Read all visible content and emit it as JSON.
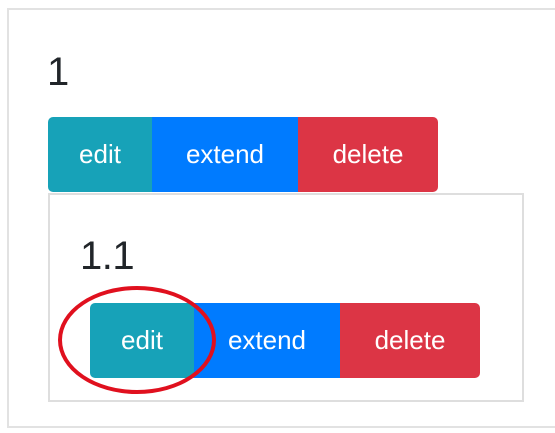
{
  "items": [
    {
      "title": "1",
      "buttons": {
        "edit": "edit",
        "extend": "extend",
        "delete": "delete"
      },
      "children": [
        {
          "title": "1.1",
          "buttons": {
            "edit": "edit",
            "extend": "extend",
            "delete": "delete"
          }
        }
      ]
    }
  ],
  "colors": {
    "edit": "#17a2b8",
    "extend": "#007bff",
    "delete": "#dc3545",
    "annotation": "#e0101e"
  }
}
